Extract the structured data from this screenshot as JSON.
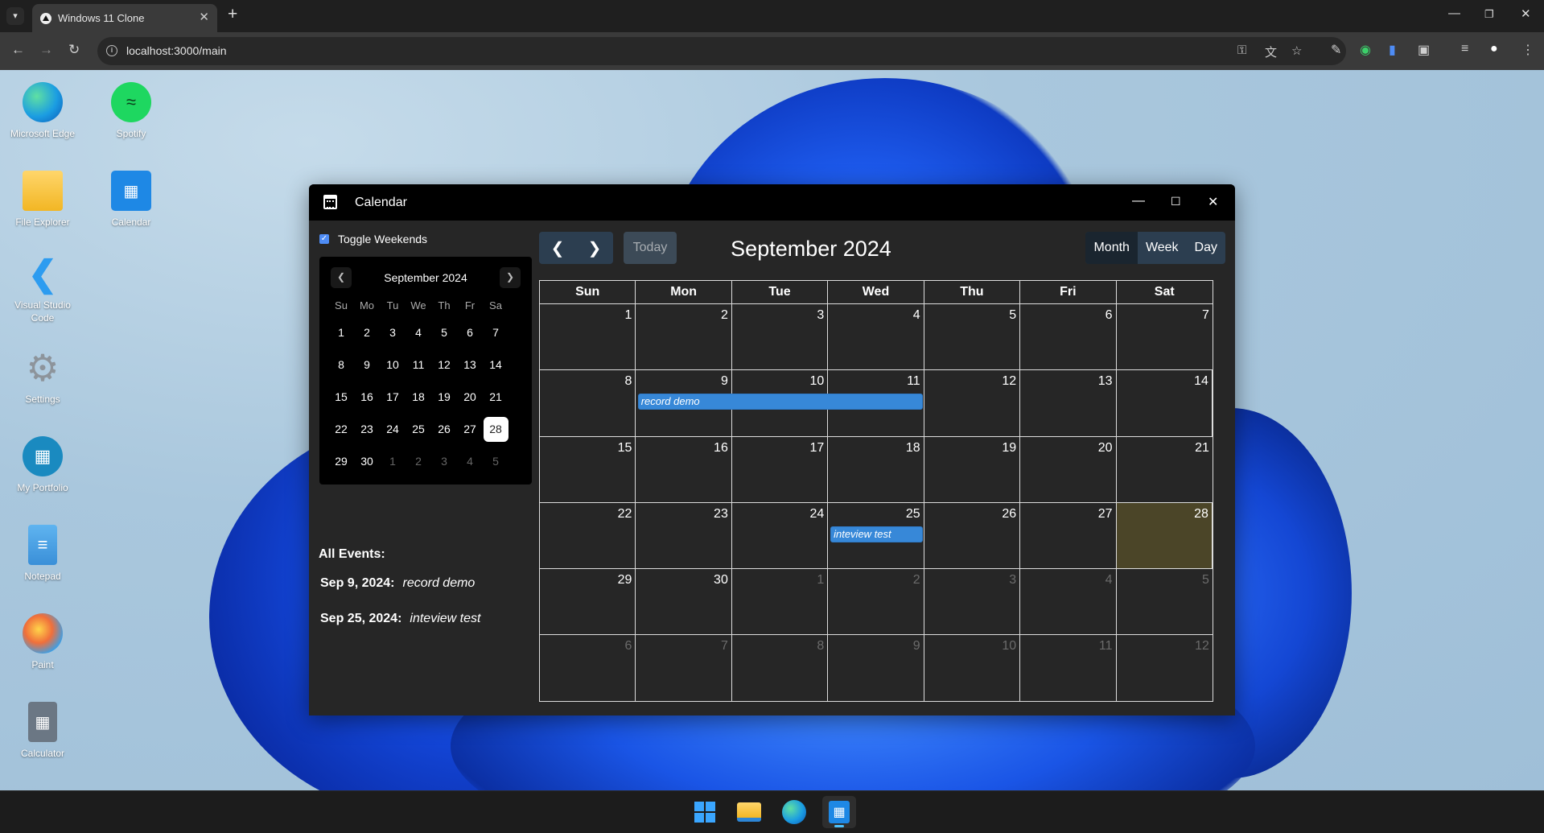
{
  "browser": {
    "tab_title": "Windows 11 Clone",
    "url": "localhost:3000/main",
    "icons": [
      "tab-search-icon",
      "new-tab-icon",
      "minimize-icon",
      "restore-icon",
      "close-icon",
      "back-icon",
      "forward-icon",
      "reload-icon",
      "site-info-icon",
      "password-key-icon",
      "translate-icon",
      "bookmark-star-icon",
      "eyedropper-icon",
      "extension-green-icon",
      "extension-blue-icon",
      "extensions-puzzle-icon",
      "reading-list-icon",
      "profile-icon",
      "menu-kebab-icon"
    ]
  },
  "desktop": {
    "icons": [
      {
        "label": "Microsoft Edge"
      },
      {
        "label": "Spotify"
      },
      {
        "label": "File Explorer"
      },
      {
        "label": "Calendar"
      },
      {
        "label": "Visual Studio Code"
      },
      {
        "label": "Settings"
      },
      {
        "label": "My Portfolio"
      },
      {
        "label": "Notepad"
      },
      {
        "label": "Paint"
      },
      {
        "label": "Calculator"
      }
    ]
  },
  "calendar_app": {
    "title": "Calendar",
    "sidebar": {
      "toggle_label": "Toggle Weekends",
      "toggle_checked": true,
      "mini_month": "September 2024",
      "weekdays": [
        "Su",
        "Mo",
        "Tu",
        "We",
        "Th",
        "Fr",
        "Sa"
      ],
      "weeks": [
        [
          "1",
          "2",
          "3",
          "4",
          "5",
          "6",
          "7"
        ],
        [
          "8",
          "9",
          "10",
          "11",
          "12",
          "13",
          "14"
        ],
        [
          "15",
          "16",
          "17",
          "18",
          "19",
          "20",
          "21"
        ],
        [
          "22",
          "23",
          "24",
          "25",
          "26",
          "27",
          "28"
        ],
        [
          "29",
          "30",
          "1",
          "2",
          "3",
          "4",
          "5"
        ]
      ],
      "selected_day": "28",
      "events_heading": "All Events:",
      "events": [
        {
          "date": "Sep 9, 2024:",
          "title": "record demo"
        },
        {
          "date": "Sep 25, 2024:",
          "title": "inteview test"
        }
      ]
    },
    "header": {
      "today_label": "Today",
      "month_title": "September 2024",
      "views": [
        "Month",
        "Week",
        "Day"
      ],
      "active_view": "Month"
    },
    "grid": {
      "day_headers": [
        "Sun",
        "Mon",
        "Tue",
        "Wed",
        "Thu",
        "Fri",
        "Sat"
      ],
      "weeks": [
        [
          "1",
          "2",
          "3",
          "4",
          "5",
          "6",
          "7"
        ],
        [
          "8",
          "9",
          "10",
          "11",
          "12",
          "13",
          "14"
        ],
        [
          "15",
          "16",
          "17",
          "18",
          "19",
          "20",
          "21"
        ],
        [
          "22",
          "23",
          "24",
          "25",
          "26",
          "27",
          "28"
        ],
        [
          "29",
          "30",
          "1",
          "2",
          "3",
          "4",
          "5"
        ],
        [
          "6",
          "7",
          "8",
          "9",
          "10",
          "11",
          "12"
        ]
      ],
      "today": "28",
      "events": [
        {
          "title": "record demo",
          "date": "2024-09-09",
          "end": "2024-09-11",
          "color": "#3788d8"
        },
        {
          "title": "inteview test",
          "date": "2024-09-25",
          "end": "2024-09-25",
          "color": "#3788d8"
        }
      ]
    }
  },
  "taskbar": {
    "apps": [
      "start-icon",
      "file-explorer-icon",
      "edge-icon",
      "calendar-icon"
    ],
    "active": "calendar-icon"
  },
  "colors": {
    "accent": "#3788d8",
    "today_highlight": "#4b4528",
    "button_bg": "#2c3e50",
    "window_bg": "#262626"
  }
}
